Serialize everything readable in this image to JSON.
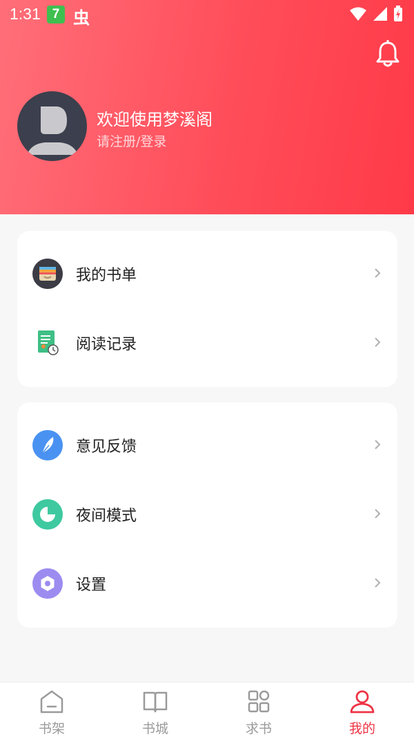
{
  "status_bar": {
    "time": "1:31",
    "app_badge": "7",
    "app_icon2": "虫"
  },
  "profile": {
    "welcome": "欢迎使用梦溪阁",
    "login_prompt": "请注册/登录"
  },
  "menu_group1": [
    {
      "label": "我的书单",
      "icon": "wallet-icon"
    },
    {
      "label": "阅读记录",
      "icon": "reading-history-icon"
    }
  ],
  "menu_group2": [
    {
      "label": "意见反馈",
      "icon": "feather-icon"
    },
    {
      "label": "夜间模式",
      "icon": "night-mode-icon"
    },
    {
      "label": "设置",
      "icon": "settings-icon"
    }
  ],
  "tabs": [
    {
      "label": "书架",
      "icon": "bookshelf-icon",
      "active": false
    },
    {
      "label": "书城",
      "icon": "book-icon",
      "active": false
    },
    {
      "label": "求书",
      "icon": "grid-icon",
      "active": false
    },
    {
      "label": "我的",
      "icon": "profile-icon",
      "active": true
    }
  ],
  "colors": {
    "header_gradient_start": "#ff6f79",
    "header_gradient_end": "#ff3a48",
    "accent": "#ee3344",
    "tab_inactive": "#9a9a9a"
  }
}
